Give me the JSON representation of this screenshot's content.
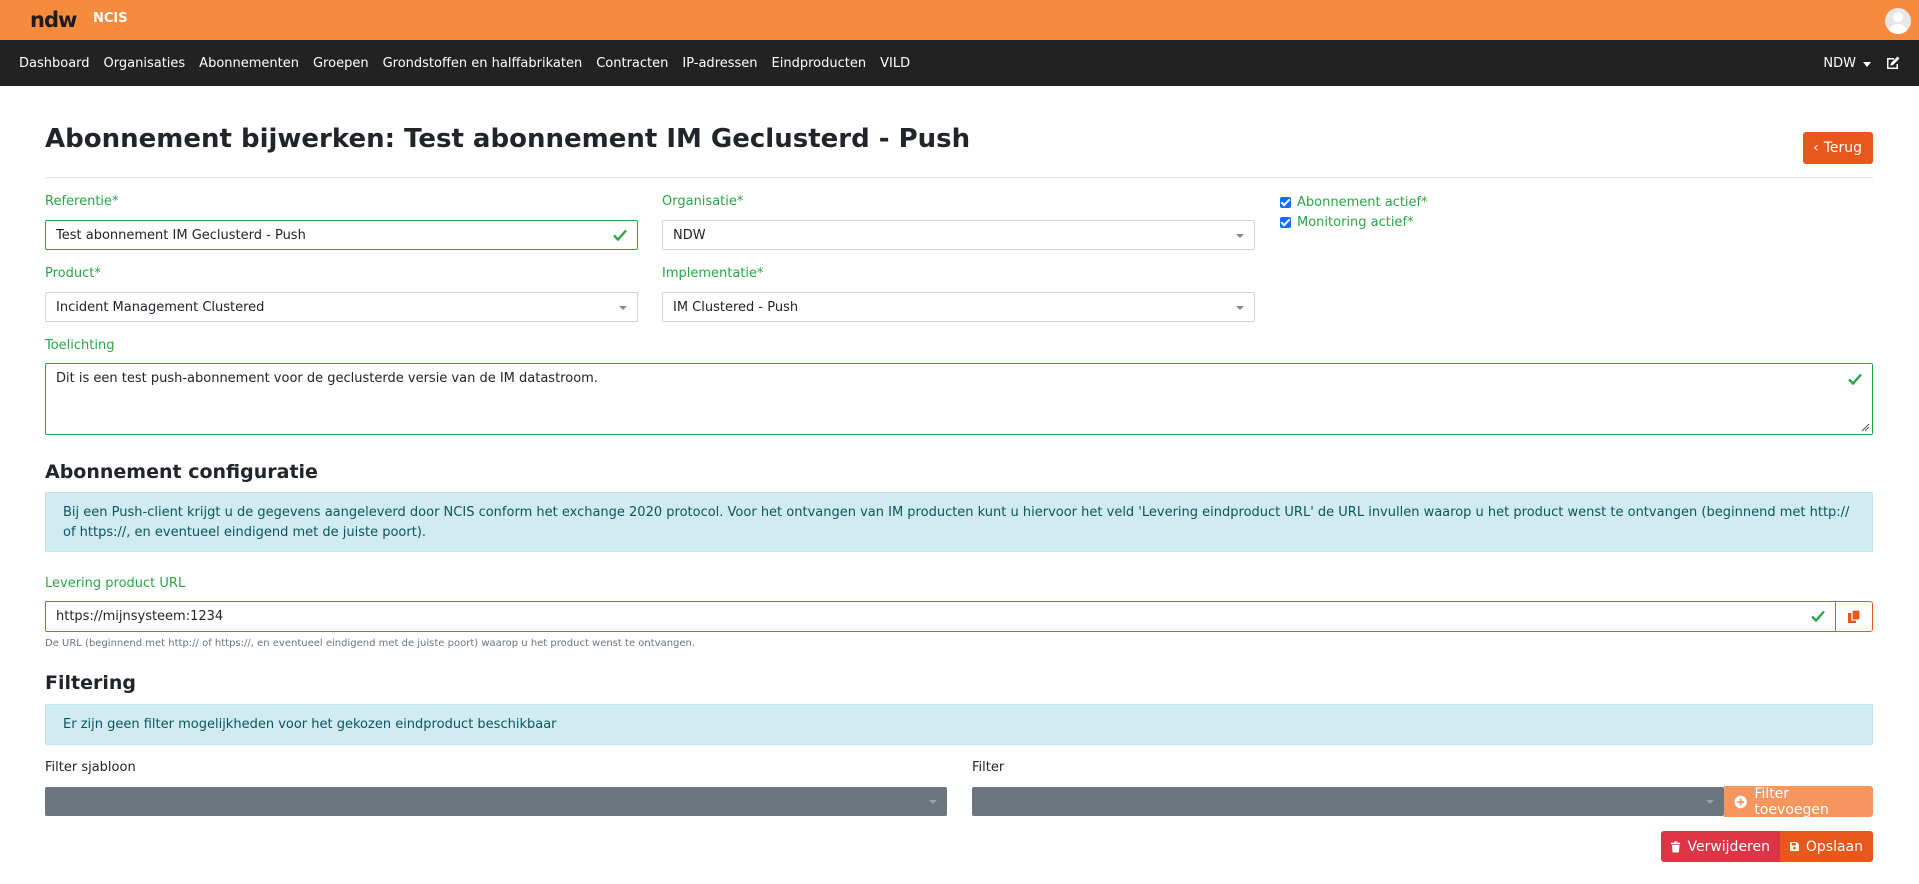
{
  "header": {
    "logo": "ndw",
    "app_name": "NCIS"
  },
  "nav": {
    "items": [
      {
        "label": "Dashboard"
      },
      {
        "label": "Organisaties"
      },
      {
        "label": "Abonnementen"
      },
      {
        "label": "Groepen"
      },
      {
        "label": "Grondstoffen en halffabrikaten"
      },
      {
        "label": "Contracten"
      },
      {
        "label": "IP-adressen"
      },
      {
        "label": "Eindproducten"
      },
      {
        "label": "VILD"
      }
    ],
    "user_menu": "NDW"
  },
  "page": {
    "title": "Abonnement bijwerken: Test abonnement IM Geclusterd - Push",
    "back_label": "Terug"
  },
  "form": {
    "referentie": {
      "label": "Referentie*",
      "value": "Test abonnement IM Geclusterd - Push"
    },
    "organisatie": {
      "label": "Organisatie*",
      "value": "NDW"
    },
    "abonnement_actief": {
      "label": "Abonnement actief*",
      "checked": true
    },
    "monitoring_actief": {
      "label": "Monitoring actief*",
      "checked": true
    },
    "product": {
      "label": "Product*",
      "value": "Incident Management Clustered"
    },
    "implementatie": {
      "label": "Implementatie*",
      "value": "IM Clustered - Push"
    },
    "toelichting": {
      "label": "Toelichting",
      "value": "Dit is een test push-abonnement voor de geclusterde versie van de IM datastroom."
    }
  },
  "config": {
    "heading": "Abonnement configuratie",
    "info": "Bij een Push-client krijgt u de gegevens aangeleverd door NCIS conform het exchange 2020 protocol. Voor het ontvangen van IM producten kunt u hiervoor het veld 'Levering eindproduct URL' de URL invullen waarop u het product wenst te ontvangen (beginnend met http:// of https://, en eventueel eindigend met de juiste poort).",
    "url_label": "Levering product URL",
    "url_value": "https://mijnsysteem:1234",
    "url_help": "De URL (beginnend met http:// of https://, en eventueel eindigend met de juiste poort) waarop u het product wenst te ontvangen."
  },
  "filtering": {
    "heading": "Filtering",
    "info": "Er zijn geen filter mogelijkheden voor het gekozen eindproduct beschikbaar",
    "template_label": "Filter sjabloon",
    "filter_label": "Filter",
    "add_label": "Filter toevoegen"
  },
  "actions": {
    "delete_label": "Verwijderen",
    "save_label": "Opslaan"
  },
  "colors": {
    "brand_orange": "#f68b3d",
    "accent_orange": "#e8571c",
    "valid_green": "#28a745",
    "danger_red": "#dc3545",
    "info_bg": "#d1ecf1"
  }
}
